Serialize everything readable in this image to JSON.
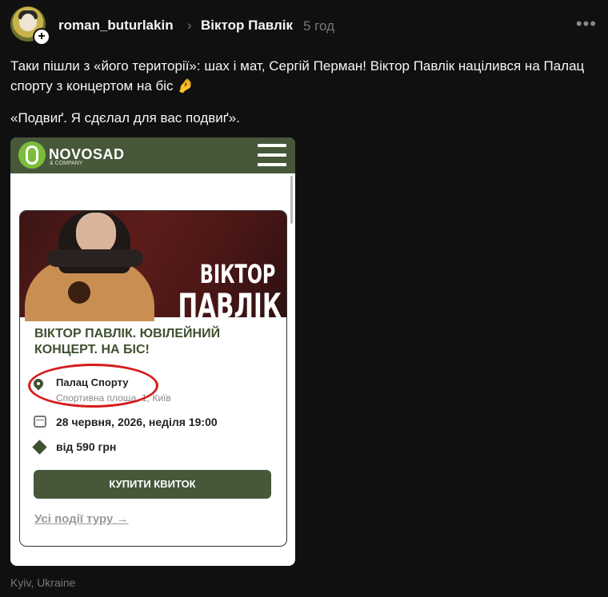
{
  "post": {
    "username": "roman_buturlakin",
    "separator": "›",
    "tag": "Віктор Павлік",
    "time": "5 год",
    "more_label": "•••",
    "text": "Таки пішли з «його території»: шах і мат, Сергій Перман! Віктор Павлік націлився на Палац спорту з концертом на біс 🤌",
    "quote": "«Подвиґ. Я сдєлал для вас подвиґ».",
    "location": "Kyiv, Ukraine"
  },
  "screenshot": {
    "site_logo": "NOVOSAD",
    "site_logo_sub": "& COMPANY",
    "hero_name_line1": "ВІКТОР",
    "hero_name_line2": "ПАВЛІК",
    "event_title": "ВІКТОР ПАВЛІК. ЮВІЛЕЙНИЙ КОНЦЕРТ. НА БІС!",
    "venue": "Палац Спорту",
    "address": "Спортивна площа, 1, Київ",
    "date": "28 червня, 2026, неділя 19:00",
    "price": "від 590 грн",
    "buy_button": "КУПИТИ КВИТОК",
    "all_events_link": "Усі події туру →"
  },
  "colors": {
    "background": "#101010",
    "brand_green": "#47573a",
    "highlight_red": "#d61c1c"
  },
  "icons": [
    "avatar",
    "plus-icon",
    "more-icon",
    "menu-icon",
    "location-pin-icon",
    "calendar-icon",
    "ticket-icon"
  ]
}
